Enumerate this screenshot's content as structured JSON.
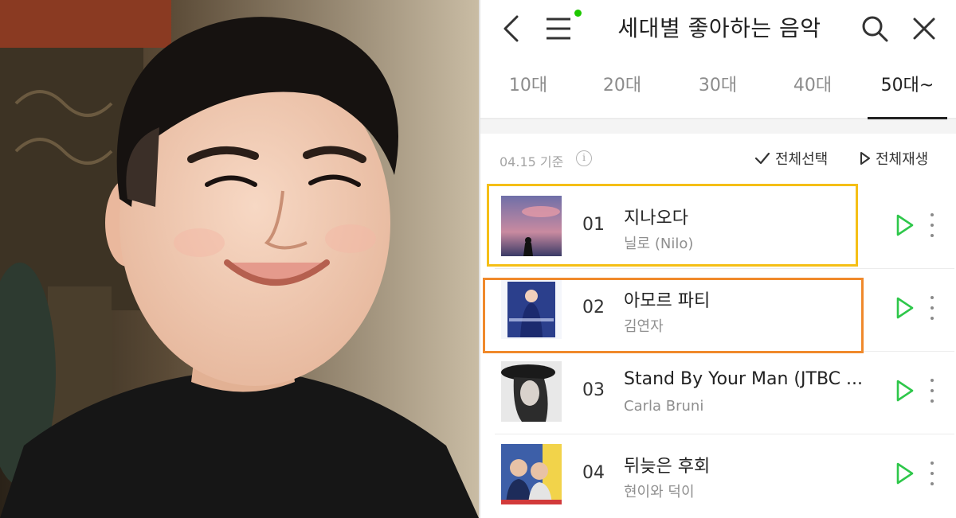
{
  "header": {
    "title": "세대별 좋아하는 음악",
    "menu_dot_color": "#1ec800"
  },
  "tabs": [
    {
      "label": "10대",
      "active": false
    },
    {
      "label": "20대",
      "active": false
    },
    {
      "label": "30대",
      "active": false
    },
    {
      "label": "40대",
      "active": false
    },
    {
      "label": "50대~",
      "active": true
    }
  ],
  "info_bar": {
    "date_label": "04.15 기준",
    "info_icon": "info-icon",
    "select_all_label": "전체선택",
    "play_all_label": "전체재생"
  },
  "songs": [
    {
      "rank": "01",
      "title": "지나오다",
      "artist": "닐로 (Nilo)",
      "highlight": "#f5bf16"
    },
    {
      "rank": "02",
      "title": "아모르 파티",
      "artist": "김연자",
      "highlight": "#f0892b"
    },
    {
      "rank": "03",
      "title": "Stand By Your Man (JTBC ...",
      "artist": "Carla Bruni"
    },
    {
      "rank": "04",
      "title": "뒤늦은 후회",
      "artist": "현이와 덕이"
    }
  ],
  "colors": {
    "play_icon": "#2ec74a",
    "accent": "#1ec800"
  }
}
